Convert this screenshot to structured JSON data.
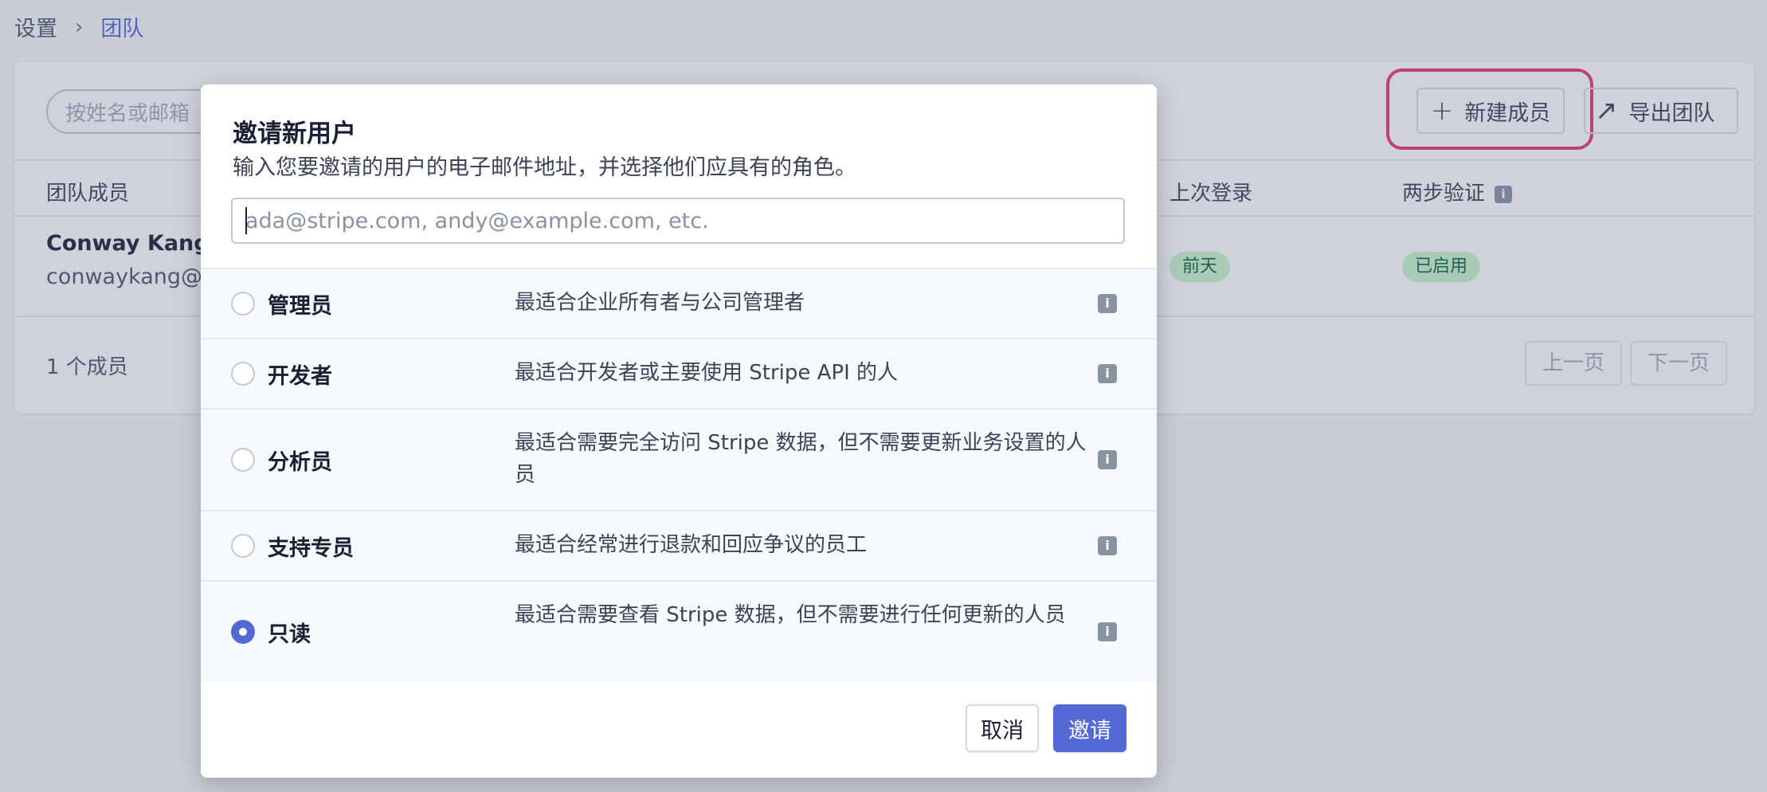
{
  "breadcrumb": {
    "root": "设置",
    "separator": "›",
    "current": "团队"
  },
  "toolbar": {
    "search_placeholder": "按姓名或邮箱",
    "new_member_label": "新建成员",
    "export_label": "导出团队"
  },
  "table": {
    "headers": {
      "member": "团队成员",
      "last_login": "上次登录",
      "two_factor": "两步验证"
    },
    "rows": [
      {
        "name": "Conway Kang",
        "email": "conwaykang@f",
        "last_login": "前天",
        "two_factor": "已启用"
      }
    ],
    "count": "1 个成员",
    "prev_label": "上一页",
    "next_label": "下一页"
  },
  "modal": {
    "title": "邀请新用户",
    "description": "输入您要邀请的用户的电子邮件地址，并选择他们应具有的角色。",
    "email_placeholder": "ada@stripe.com, andy@example.com, etc.",
    "email_value": "",
    "roles": [
      {
        "name": "管理员",
        "description": "最适合企业所有者与公司管理者",
        "checked": false
      },
      {
        "name": "开发者",
        "description": "最适合开发者或主要使用 Stripe API 的人",
        "checked": false
      },
      {
        "name": "分析员",
        "description": "最适合需要完全访问 Stripe 数据，但不需要更新业务设置的人员",
        "checked": false
      },
      {
        "name": "支持专员",
        "description": "最适合经常进行退款和回应争议的员工",
        "checked": false
      },
      {
        "name": "只读",
        "description": "最适合需要查看 Stripe 数据，但不需要进行任何更新的人员",
        "checked": true
      }
    ],
    "cancel_label": "取消",
    "invite_label": "邀请"
  },
  "colors": {
    "accent": "#5469d4",
    "highlight": "#e43a6f",
    "success_bg": "#cbf4c9",
    "success_text": "#0e6245"
  },
  "icons": {
    "breadcrumb_separator": "chevron-right-icon",
    "new_member": "plus-icon",
    "export": "arrow-up-right-icon",
    "info": "info-icon"
  }
}
